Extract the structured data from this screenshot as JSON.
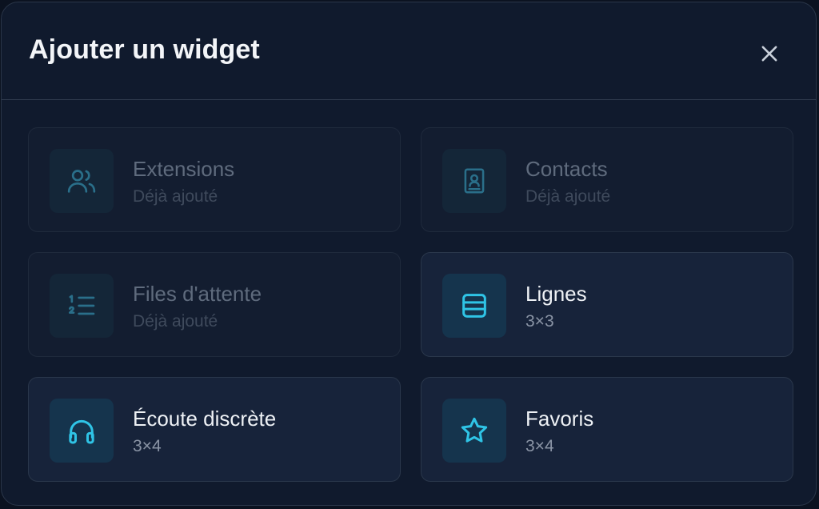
{
  "dialog": {
    "title": "Ajouter un widget",
    "close_icon": "close-icon"
  },
  "widgets": [
    {
      "name": "Extensions",
      "sub": "Déjà ajouté",
      "icon": "users-icon",
      "disabled": true
    },
    {
      "name": "Contacts",
      "sub": "Déjà ajouté",
      "icon": "contact-book-icon",
      "disabled": true
    },
    {
      "name": "Files d'attente",
      "sub": "Déjà ajouté",
      "icon": "numbered-list-icon",
      "disabled": true
    },
    {
      "name": "Lignes",
      "sub": "3×3",
      "icon": "rows-icon",
      "disabled": false
    },
    {
      "name": "Écoute discrète",
      "sub": "3×4",
      "icon": "headphones-icon",
      "disabled": false
    },
    {
      "name": "Favoris",
      "sub": "3×4",
      "icon": "star-icon",
      "disabled": false
    }
  ],
  "colors": {
    "background": "#101a2d",
    "accent": "#2fc4e6",
    "card": "#17233a"
  }
}
